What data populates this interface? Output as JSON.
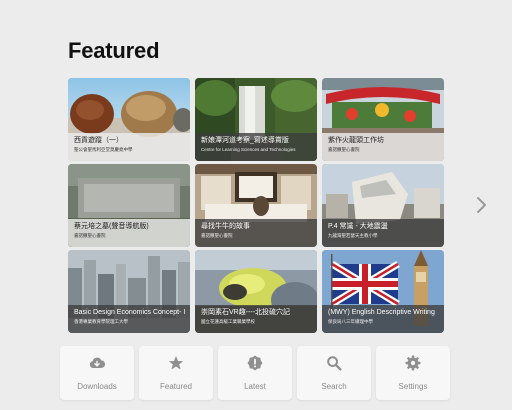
{
  "page_title": "Featured",
  "cards": [
    {
      "title": "西貢遊蹤（一）",
      "subtitle": "聖公會聖馬利亞堂莫慶堯中學",
      "caption_style": "light"
    },
    {
      "title": "新娘潭河道考察_寫述導賞版",
      "subtitle": "Centre for Learning Sciences and Technologies",
      "caption_style": "dark"
    },
    {
      "title": "紫作火龍頭工作坊",
      "subtitle": "嘉諾撒聖心書院",
      "caption_style": "light"
    },
    {
      "title": "蔡元培之墓(聲音導航版)",
      "subtitle": "嘉諾撒聖心書院",
      "caption_style": "light"
    },
    {
      "title": "尋找牛牛的故事",
      "subtitle": "嘉諾撒聖心書院",
      "caption_style": "dark"
    },
    {
      "title": "P.4 常識 - 大地震盪",
      "subtitle": "九龍灣聖若瑟天主教小學",
      "caption_style": "dark"
    },
    {
      "title": "Basic Design Economics Concept- II",
      "subtitle": "香港專業教育學院理工大學",
      "caption_style": "dark"
    },
    {
      "title": "崇岡素石VR趣----北投硫穴記",
      "subtitle": "國立花蓮高級工業職業學校",
      "caption_style": "dark"
    },
    {
      "title": "(MWY) English Descriptive Writing",
      "subtitle": "保良局八三年總理中學",
      "caption_style": "dark"
    }
  ],
  "tabs": [
    {
      "label": "Downloads",
      "icon": "cloud-download-icon"
    },
    {
      "label": "Featured",
      "icon": "star-icon"
    },
    {
      "label": "Latest",
      "icon": "exclamation-icon"
    },
    {
      "label": "Search",
      "icon": "search-icon"
    },
    {
      "label": "Settings",
      "icon": "gear-icon"
    }
  ],
  "next_icon": "chevron-right-icon"
}
